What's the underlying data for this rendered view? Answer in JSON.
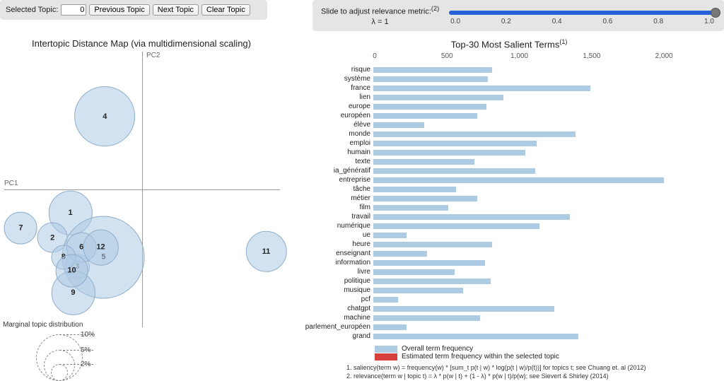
{
  "controls": {
    "selected_topic_label": "Selected Topic:",
    "selected_topic_value": "0",
    "prev_label": "Previous Topic",
    "next_label": "Next Topic",
    "clear_label": "Clear Topic",
    "slider_title": "Slide to adjust relevance metric:",
    "slider_title_sup": "(2)",
    "lambda_label": "λ = 1",
    "slider_ticks": [
      "0.0",
      "0.2",
      "0.4",
      "0.6",
      "0.8",
      "1.0"
    ]
  },
  "left": {
    "title": "Intertopic Distance Map (via multidimensional scaling)",
    "pc1_label": "PC1",
    "pc2_label": "PC2",
    "legend_title": "Marginal topic distribution",
    "legend_levels": [
      "2%",
      "5%",
      "10%"
    ]
  },
  "right": {
    "title": "Top-30 Most Salient Terms",
    "title_sup": "(1)",
    "axis_ticks": [
      "0",
      "500",
      "1,000",
      "1,500",
      "2,000"
    ],
    "legend_overall": "Overall term frequency",
    "legend_selected": "Estimated term frequency within the selected topic",
    "footnote1": "1. saliency(term w) = frequency(w) * [sum_t p(t | w) * log(p(t | w)/p(t))] for topics t; see Chuang et. al (2012)",
    "footnote2": "2. relevance(term w | topic t) = λ * p(w | t) + (1 - λ) * p(w | t)/p(w); see Sievert & Shirley (2014)"
  },
  "chart_data": {
    "scatter": {
      "type": "scatter",
      "title": "Intertopic Distance Map (via multidimensional scaling)",
      "xlabel": "PC1",
      "ylabel": "PC2",
      "xlim": [
        -1,
        1
      ],
      "ylim": [
        -1,
        1
      ],
      "bubbles": [
        {
          "id": "1",
          "x": -0.52,
          "y": -0.17,
          "r": 0.08
        },
        {
          "id": "2",
          "x": -0.65,
          "y": -0.35,
          "r": 0.055
        },
        {
          "id": "3",
          "x": -0.47,
          "y": -0.56,
          "r": 0.046
        },
        {
          "id": "4",
          "x": -0.27,
          "y": 0.53,
          "r": 0.11
        },
        {
          "id": "5",
          "x": -0.28,
          "y": -0.49,
          "r": 0.15
        },
        {
          "id": "6",
          "x": -0.44,
          "y": -0.42,
          "r": 0.055
        },
        {
          "id": "7",
          "x": -0.88,
          "y": -0.28,
          "r": 0.06
        },
        {
          "id": "8",
          "x": -0.57,
          "y": -0.49,
          "r": 0.045
        },
        {
          "id": "9",
          "x": -0.5,
          "y": -0.75,
          "r": 0.08
        },
        {
          "id": "10",
          "x": -0.51,
          "y": -0.59,
          "r": 0.06
        },
        {
          "id": "11",
          "x": 0.9,
          "y": -0.45,
          "r": 0.075
        },
        {
          "id": "12",
          "x": -0.3,
          "y": -0.42,
          "r": 0.065
        }
      ]
    },
    "bars": {
      "type": "bar",
      "title": "Top-30 Most Salient Terms",
      "xlabel": "",
      "ylabel": "",
      "xlim": [
        0,
        2200
      ],
      "ticks": [
        0,
        500,
        1000,
        1500,
        2000
      ],
      "terms": [
        {
          "term": "risque",
          "value": 820
        },
        {
          "term": "système",
          "value": 790
        },
        {
          "term": "france",
          "value": 1500
        },
        {
          "term": "lien",
          "value": 900
        },
        {
          "term": "europe",
          "value": 780
        },
        {
          "term": "européen",
          "value": 720
        },
        {
          "term": "élève",
          "value": 350
        },
        {
          "term": "monde",
          "value": 1400
        },
        {
          "term": "emploi",
          "value": 1130
        },
        {
          "term": "humain",
          "value": 1050
        },
        {
          "term": "texte",
          "value": 700
        },
        {
          "term": "ia_génératif",
          "value": 1120
        },
        {
          "term": "entreprise",
          "value": 2010
        },
        {
          "term": "tâche",
          "value": 570
        },
        {
          "term": "métier",
          "value": 720
        },
        {
          "term": "film",
          "value": 520
        },
        {
          "term": "travail",
          "value": 1360
        },
        {
          "term": "numérique",
          "value": 1150
        },
        {
          "term": "ue",
          "value": 230
        },
        {
          "term": "heure",
          "value": 820
        },
        {
          "term": "enseignant",
          "value": 370
        },
        {
          "term": "information",
          "value": 770
        },
        {
          "term": "livre",
          "value": 560
        },
        {
          "term": "politique",
          "value": 810
        },
        {
          "term": "musique",
          "value": 620
        },
        {
          "term": "pcf",
          "value": 170
        },
        {
          "term": "chatgpt",
          "value": 1250
        },
        {
          "term": "machine",
          "value": 740
        },
        {
          "term": "parlement_européen",
          "value": 230
        },
        {
          "term": "grand",
          "value": 1420
        }
      ]
    }
  }
}
